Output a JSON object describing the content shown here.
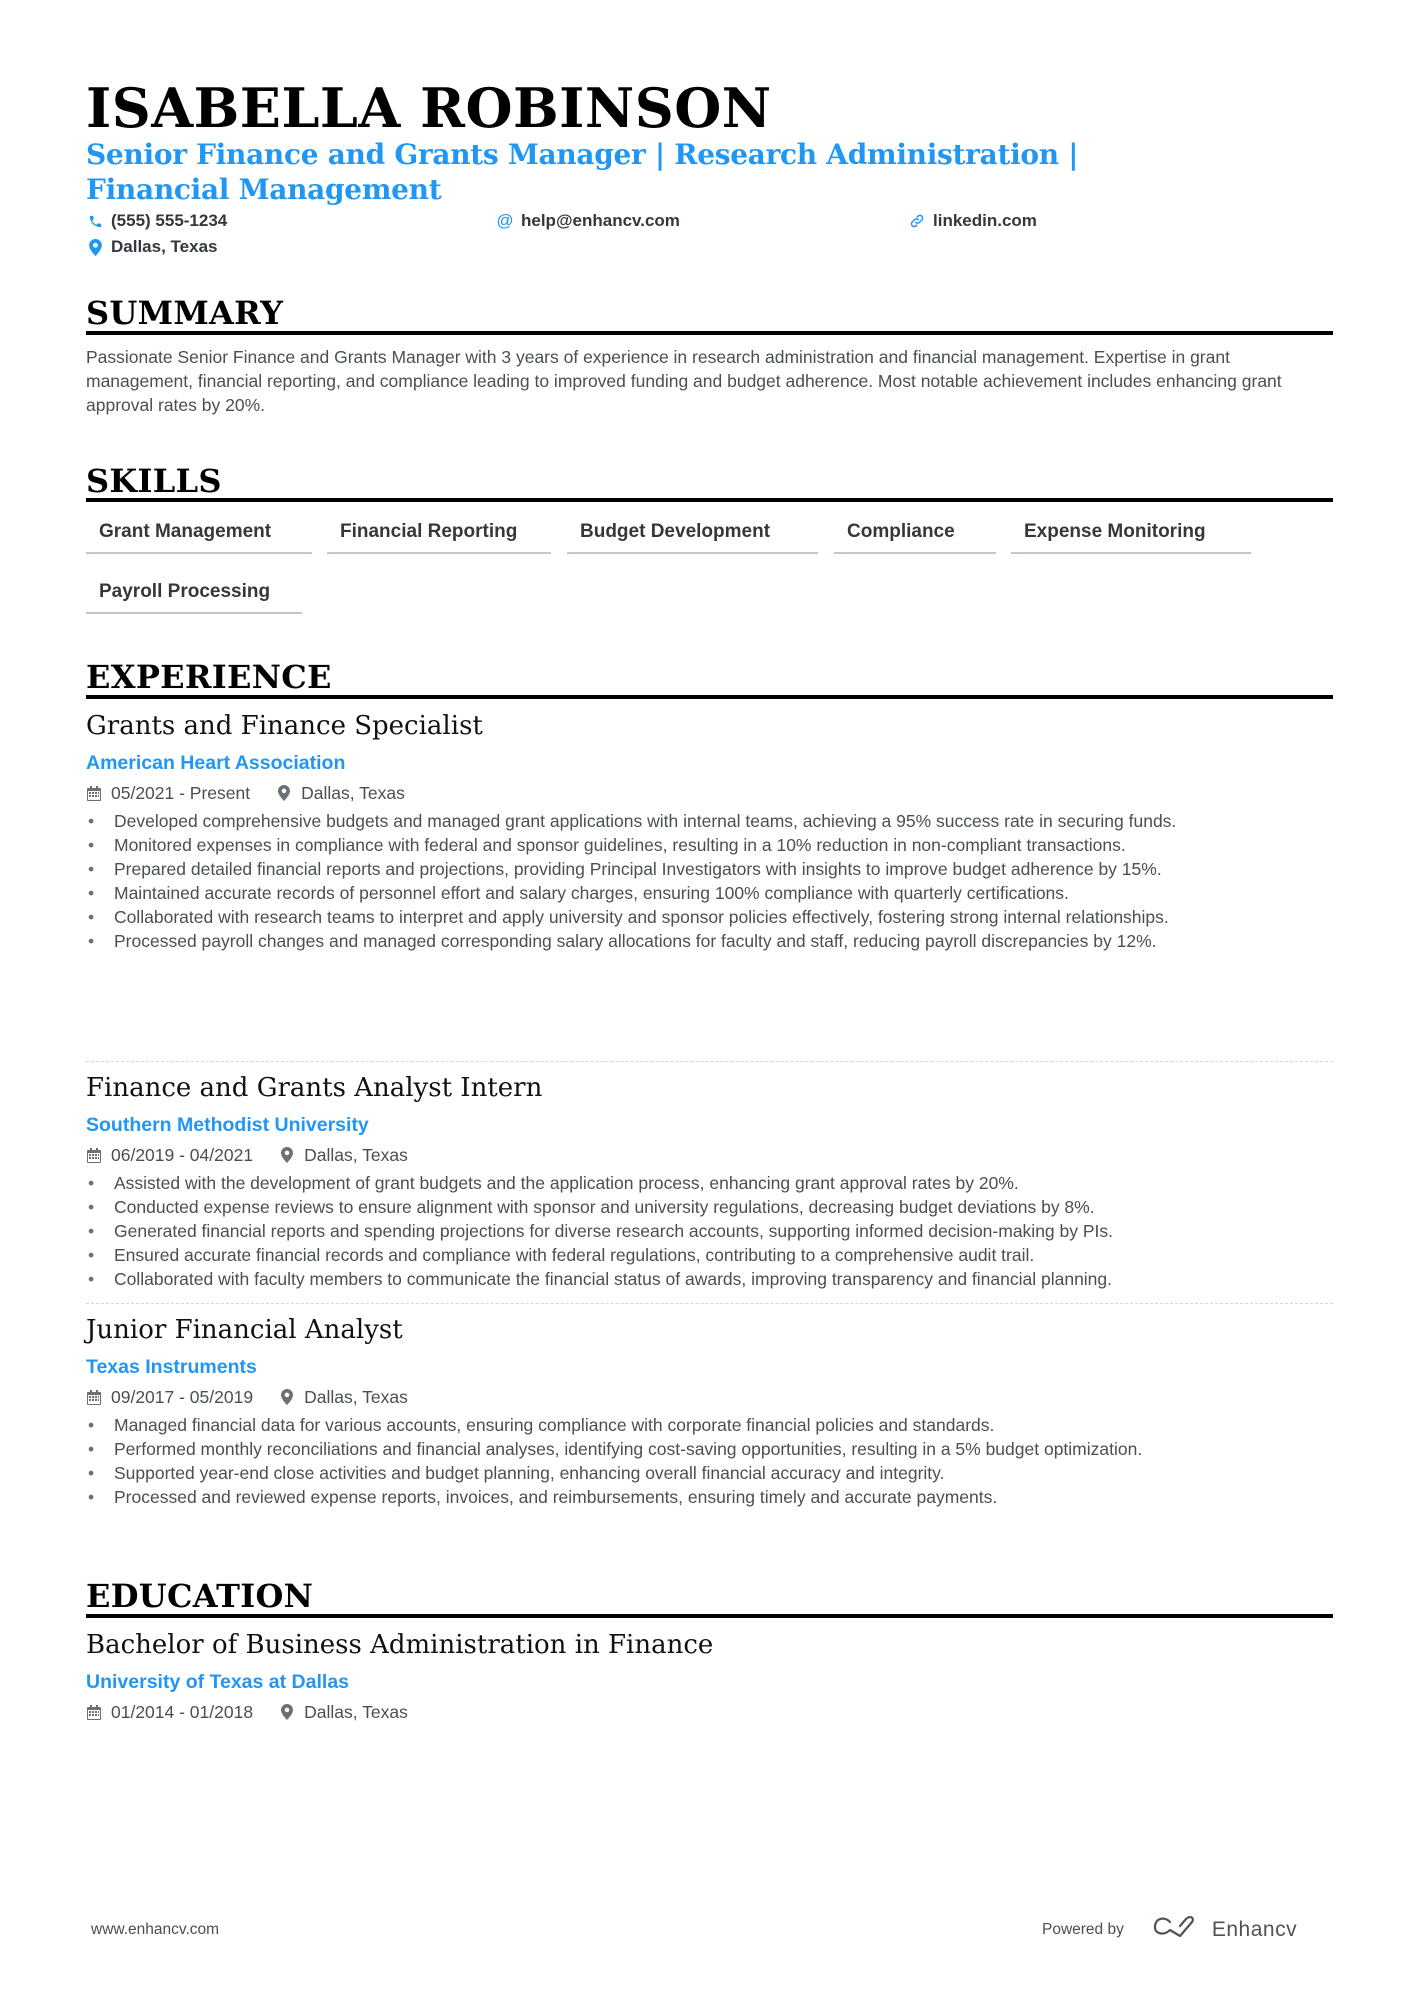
{
  "header": {
    "name": "ISABELLA ROBINSON",
    "headline": "Senior Finance and Grants Manager | Research Administration | Financial Management",
    "contacts": {
      "phone": {
        "icon": "phone-icon",
        "text": "(555) 555-1234"
      },
      "email": {
        "icon": "at-icon",
        "text": "help@enhancv.com"
      },
      "linkedin": {
        "icon": "link-icon",
        "text": "linkedin.com"
      },
      "location": {
        "icon": "map-pin-icon",
        "text": "Dallas, Texas"
      }
    }
  },
  "colors": {
    "accent": "#2196f3",
    "heading": "#000000",
    "body": "#4a4f54"
  },
  "summary": {
    "title": "SUMMARY",
    "text": "Passionate Senior Finance and Grants Manager with 3 years of experience in research administration and financial management. Expertise in grant management, financial reporting, and compliance leading to improved funding and budget adherence. Most notable achievement includes enhancing grant approval rates by 20%."
  },
  "skills": {
    "title": "SKILLS",
    "items": [
      "Grant Management",
      "Financial Reporting",
      "Budget Development",
      "Compliance",
      "Expense Monitoring",
      "Payroll Processing"
    ]
  },
  "experience": {
    "title": "EXPERIENCE",
    "jobs": [
      {
        "title": "Grants and Finance Specialist",
        "company": "American Heart Association",
        "dates": "05/2021 - Present",
        "location": "Dallas, Texas",
        "bullets": [
          "Developed comprehensive budgets and managed grant applications with internal teams, achieving a 95% success rate in securing funds.",
          "Monitored expenses in compliance with federal and sponsor guidelines, resulting in a 10% reduction in non-compliant transactions.",
          "Prepared detailed financial reports and projections, providing Principal Investigators with insights to improve budget adherence by 15%.",
          "Maintained accurate records of personnel effort and salary charges, ensuring 100% compliance with quarterly certifications.",
          "Collaborated with research teams to interpret and apply university and sponsor policies effectively, fostering strong internal relationships.",
          "Processed payroll changes and managed corresponding salary allocations for faculty and staff, reducing payroll discrepancies by 12%."
        ]
      },
      {
        "title": "Finance and Grants Analyst Intern",
        "company": "Southern Methodist University",
        "dates": "06/2019 - 04/2021",
        "location": "Dallas, Texas",
        "bullets": [
          "Assisted with the development of grant budgets and the application process, enhancing grant approval rates by 20%.",
          "Conducted expense reviews to ensure alignment with sponsor and university regulations, decreasing budget deviations by 8%.",
          "Generated financial reports and spending projections for diverse research accounts, supporting informed decision-making by PIs.",
          "Ensured accurate financial records and compliance with federal regulations, contributing to a comprehensive audit trail.",
          "Collaborated with faculty members to communicate the financial status of awards, improving transparency and financial planning."
        ]
      },
      {
        "title": "Junior Financial Analyst",
        "company": "Texas Instruments",
        "dates": "09/2017 - 05/2019",
        "location": "Dallas, Texas",
        "bullets": [
          "Managed financial data for various accounts, ensuring compliance with corporate financial policies and standards.",
          "Performed monthly reconciliations and financial analyses, identifying cost-saving opportunities, resulting in a 5% budget optimization.",
          "Supported year-end close activities and budget planning, enhancing overall financial accuracy and integrity.",
          "Processed and reviewed expense reports, invoices, and reimbursements, ensuring timely and accurate payments."
        ]
      }
    ]
  },
  "education": {
    "title": "EDUCATION",
    "items": [
      {
        "degree": "Bachelor of Business Administration in Finance",
        "school": "University of Texas at Dallas",
        "dates": "01/2014 - 01/2018",
        "location": "Dallas, Texas"
      }
    ]
  },
  "footer": {
    "website": "www.enhancv.com",
    "powered_by": "Powered by",
    "brand": "Enhancv"
  }
}
